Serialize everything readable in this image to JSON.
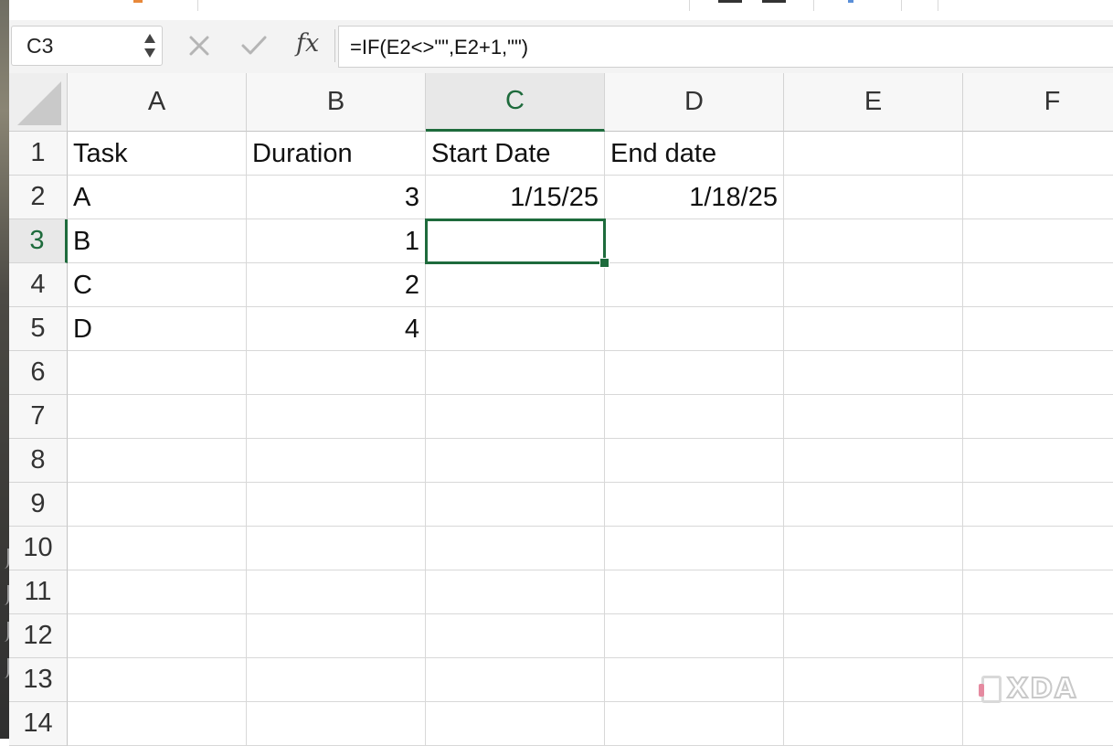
{
  "formula_bar": {
    "name_box": "C3",
    "fx_label": "fx",
    "formula": "=IF(E2<>\"\",E2+1,\"\")"
  },
  "columns": [
    "A",
    "B",
    "C",
    "D",
    "E",
    "F"
  ],
  "rows": [
    "1",
    "2",
    "3",
    "4",
    "5",
    "6",
    "7",
    "8",
    "9",
    "10",
    "11",
    "12",
    "13",
    "14"
  ],
  "active_cell": "C3",
  "cells": {
    "A1": "Task",
    "B1": "Duration",
    "C1": "Start Date",
    "D1": "End date",
    "A2": "A",
    "B2": "3",
    "C2": "1/15/25",
    "D2": "1/18/25",
    "A3": "B",
    "B3": "1",
    "A4": "C",
    "B4": "2",
    "A5": "D",
    "B5": "4"
  },
  "watermark": "XDA",
  "colors": {
    "accent": "#1e6b3c",
    "header_bg": "#f7f7f7",
    "grid_line": "#d8d8d8"
  }
}
